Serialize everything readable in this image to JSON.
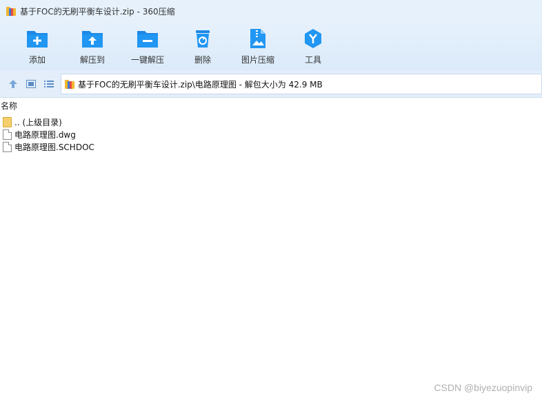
{
  "window": {
    "title": "基于FOC的无刷平衡车设计.zip - 360压缩"
  },
  "toolbar": {
    "items": [
      {
        "label": "添加",
        "icon": "add-icon"
      },
      {
        "label": "解压到",
        "icon": "extract-to-icon"
      },
      {
        "label": "一键解压",
        "icon": "one-click-extract-icon"
      },
      {
        "label": "删除",
        "icon": "delete-icon"
      },
      {
        "label": "图片压缩",
        "icon": "image-compress-icon"
      },
      {
        "label": "工具",
        "icon": "tools-icon"
      }
    ]
  },
  "address": {
    "path": "基于FOC的无刷平衡车设计.zip\\电路原理图 - 解包大小为 42.9 MB"
  },
  "list": {
    "header_name": "名称",
    "rows": [
      {
        "name": ".. (上级目录)",
        "type": "folder"
      },
      {
        "name": "电路原理图.dwg",
        "type": "file"
      },
      {
        "name": "电路原理图.SCHDOC",
        "type": "file"
      }
    ]
  },
  "watermark": "CSDN @biyezuopinvip",
  "colors": {
    "accent": "#1e88e5",
    "titlebar_bg": "#e6f1fc",
    "folder": "#f5cf6b"
  }
}
